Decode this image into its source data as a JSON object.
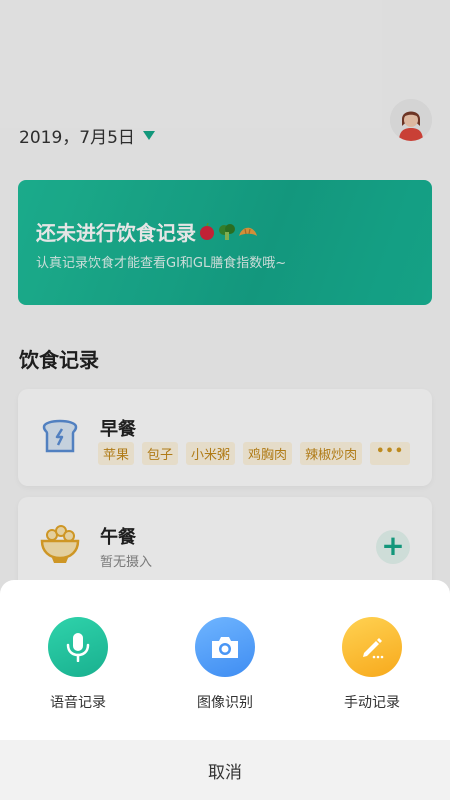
{
  "header": {
    "date": "2019，7月5日"
  },
  "banner": {
    "title": "还未进行饮食记录",
    "subtitle": "认真记录饮食才能查看GI和GL膳食指数哦~"
  },
  "section": {
    "title": "饮食记录"
  },
  "meals": {
    "breakfast": {
      "title": "早餐",
      "tags": [
        "苹果",
        "包子",
        "小米粥",
        "鸡胸肉",
        "辣椒炒肉"
      ],
      "more": "•••"
    },
    "lunch": {
      "title": "午餐",
      "subtitle": "暂无摄入"
    }
  },
  "sheet": {
    "options": [
      {
        "label": "语音记录",
        "icon": "microphone-icon",
        "color": "#1fbf9b"
      },
      {
        "label": "图像识别",
        "icon": "camera-icon",
        "color": "#4a96f5"
      },
      {
        "label": "手动记录",
        "icon": "pencil-icon",
        "color": "#f8ae22"
      }
    ],
    "cancel": "取消"
  },
  "colors": {
    "accent": "#16a98a",
    "tag_bg": "#fff5e0",
    "tag_text": "#c58a1a"
  }
}
